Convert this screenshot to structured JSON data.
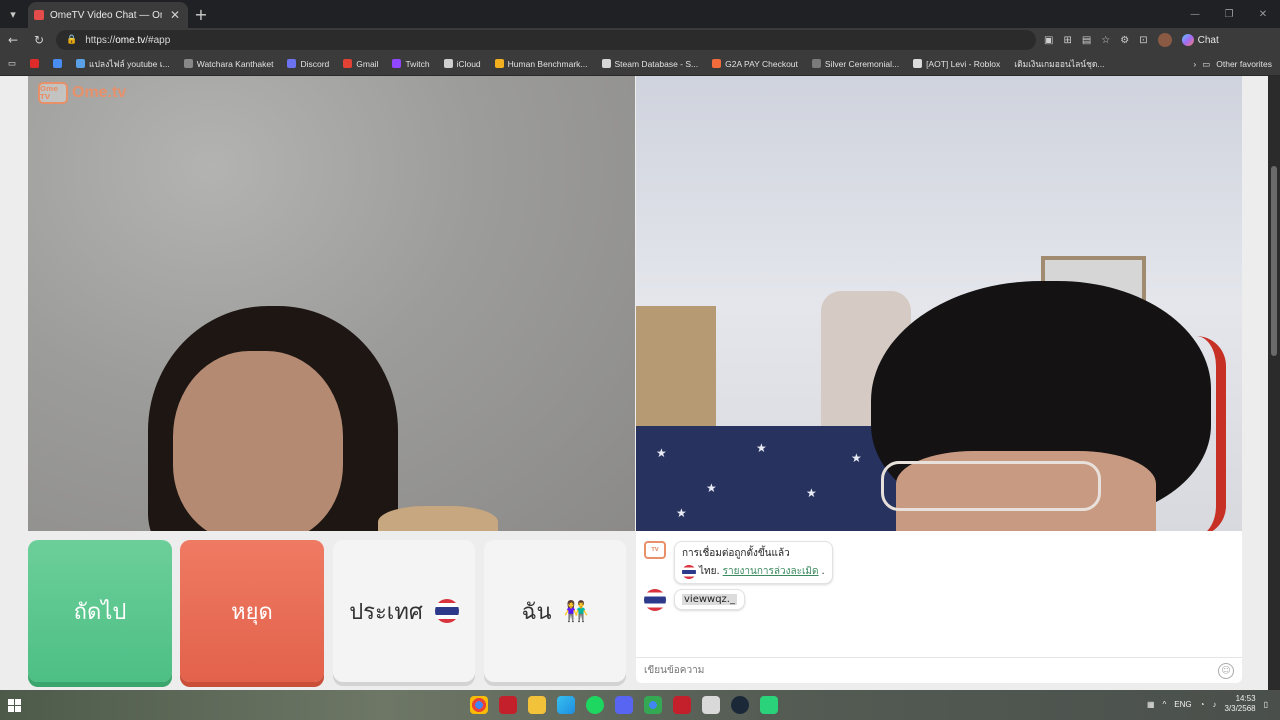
{
  "browser": {
    "tab_title": "OmeTV Video Chat — Omegle",
    "url_prefix": "https://",
    "url_domain": "ome.tv",
    "url_path": "/#app",
    "copilot_label": "Chat",
    "bookmarks": [
      "แปลงไฟล์ youtube เ...",
      "Watchara Kanthaket",
      "Discord",
      "Gmail",
      "Twitch",
      "iCloud",
      "Human Benchmark...",
      "Steam Database - S...",
      "G2A PAY Checkout",
      "Silver Ceremonial...",
      "[AOT] Levi - Roblox",
      "เติมเงินเกมออนไลน์ชุด..."
    ],
    "other_favorites": "Other favorites"
  },
  "app": {
    "logo_small": "Ome TV",
    "logo_text": "Ome.tv"
  },
  "buttons": {
    "next": "ถัดไป",
    "stop": "หยุด",
    "country": "ประเทศ",
    "me": "ฉัน",
    "me_emoji": "👫"
  },
  "chat": {
    "system_message": "การเชื่อมต่อถูกตั้งขึ้นแล้ว",
    "country_prefix": "ไทย.",
    "report_link": "รายงานการล่วงละเมิด",
    "report_suffix": ".",
    "partner_username": "viewwqz._",
    "input_placeholder": "เขียนข้อความ"
  },
  "taskbar": {
    "weather_line1": "",
    "weather_line2": "",
    "lang": "ENG",
    "time": "14:53",
    "date": "3/3/2568"
  },
  "colors": {
    "next_green": "#4dbf85",
    "stop_red": "#e3624b",
    "brand_orange": "#e7906a",
    "link_green": "#3a8a5e"
  }
}
